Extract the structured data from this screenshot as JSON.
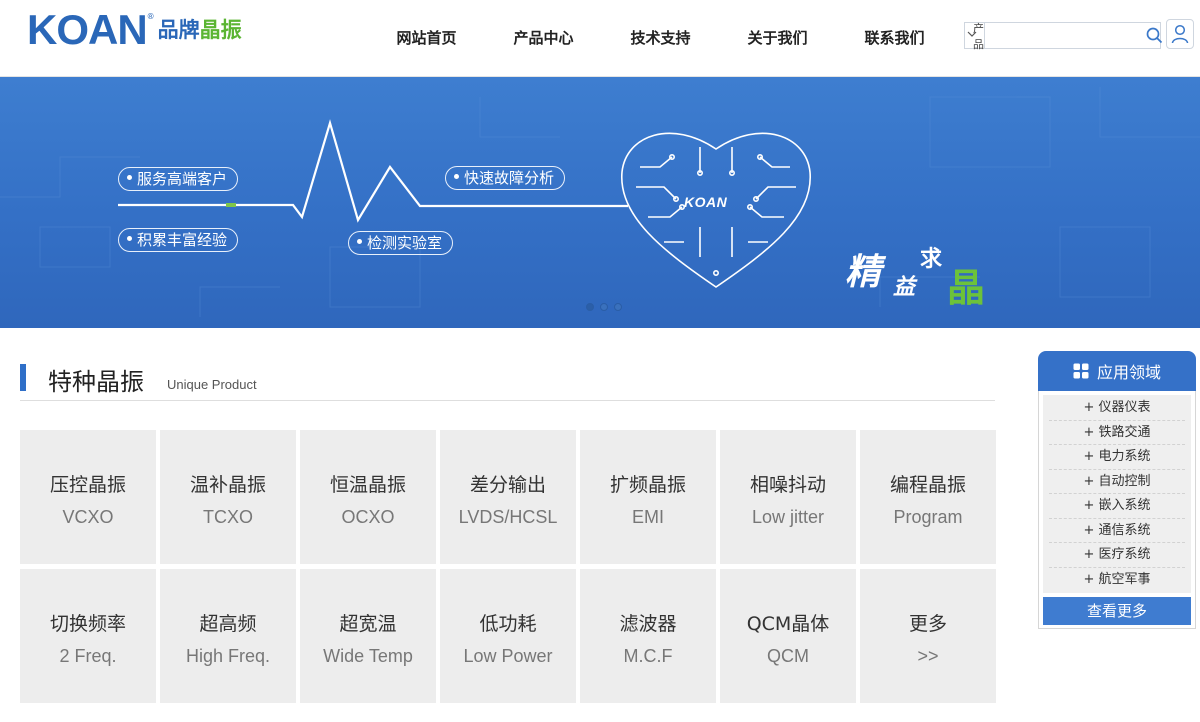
{
  "header": {
    "logo_mark": "KOAN",
    "logo_reg": "®",
    "logo_cn_a": "品牌",
    "logo_cn_b": "晶振",
    "nav": [
      "网站首页",
      "产品中心",
      "技术支持",
      "关于我们",
      "联系我们"
    ],
    "search": {
      "select_value": "产品",
      "placeholder": ""
    }
  },
  "banner": {
    "tags": [
      "服务高端客户",
      "积累丰富经验",
      "快速故障分析",
      "检测实验室"
    ],
    "heart_logo": "KOAN",
    "slogan": [
      "精",
      "益",
      "求",
      "晶"
    ],
    "slide_count": 3,
    "active_slide": 1
  },
  "section": {
    "title": "特种晶振",
    "subtitle": "Unique Product"
  },
  "products": [
    {
      "cn": "压控晶振",
      "en": "VCXO"
    },
    {
      "cn": "温补晶振",
      "en": "TCXO"
    },
    {
      "cn": "恒温晶振",
      "en": "OCXO"
    },
    {
      "cn": "差分输出",
      "en": "LVDS/HCSL"
    },
    {
      "cn": "扩频晶振",
      "en": "EMI"
    },
    {
      "cn": "相噪抖动",
      "en": "Low jitter"
    },
    {
      "cn": "编程晶振",
      "en": "Program"
    },
    {
      "cn": "切换频率",
      "en": "2 Freq."
    },
    {
      "cn": "超高频",
      "en": "High Freq."
    },
    {
      "cn": "超宽温",
      "en": "Wide Temp"
    },
    {
      "cn": "低功耗",
      "en": "Low Power"
    },
    {
      "cn": "滤波器",
      "en": "M.C.F"
    },
    {
      "cn": "QCM晶体",
      "en": "QCM"
    },
    {
      "cn": "更多",
      "en": ">>"
    }
  ],
  "sidebar": {
    "title": "应用领域",
    "items": [
      "+ 仪器仪表",
      "+ 铁路交通",
      "+ 电力系统",
      "+ 自动控制",
      "+ 嵌入系统",
      "+ 通信系统",
      "+ 医疗系统",
      "+ 航空军事"
    ],
    "more": "查看更多"
  },
  "colors": {
    "brand_blue": "#2a67b8",
    "brand_green": "#5bb533",
    "banner_blue": "#3470c6",
    "tile_gray": "#ededed"
  }
}
